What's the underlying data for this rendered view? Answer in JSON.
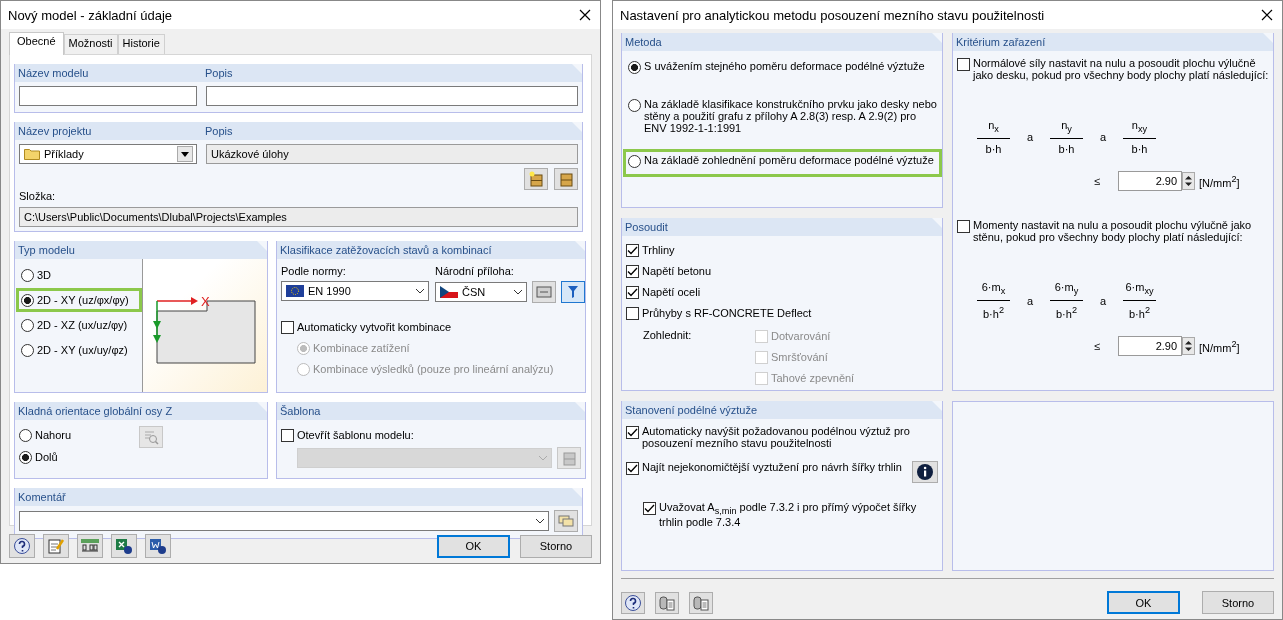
{
  "left_dialog": {
    "title": "Nový model - základní údaje",
    "tabs": [
      {
        "label": "Obecné",
        "selected": true
      },
      {
        "label": "Možnosti",
        "selected": false
      },
      {
        "label": "Historie",
        "selected": false
      }
    ],
    "model": {
      "name_label": "Název modelu",
      "description_label": "Popis"
    },
    "project": {
      "name_label": "Název projektu",
      "name_value": "Příklady",
      "description_label": "Popis",
      "description_value": "Ukázkové úlohy",
      "folder_label": "Složka:",
      "folder_value": "C:\\Users\\Public\\Documents\\Dlubal\\Projects\\Examples"
    },
    "model_type": {
      "title": "Typ modelu",
      "axis_label": "X",
      "options": [
        {
          "label": "3D",
          "selected": false,
          "highlighted": false
        },
        {
          "label": "2D - XY (uz/φx/φy)",
          "selected": true,
          "highlighted": true
        },
        {
          "label": "2D - XZ (ux/uz/φy)",
          "selected": false,
          "highlighted": false
        },
        {
          "label": "2D - XY (ux/uy/φz)",
          "selected": false,
          "highlighted": false
        }
      ]
    },
    "classification": {
      "title": "Klasifikace zatěžovacích stavů a kombinací",
      "norm_label": "Podle normy:",
      "norm_value": "EN 1990",
      "annex_label": "Národní příloha:",
      "annex_value": "ČSN",
      "auto_combinations": {
        "label": "Automaticky vytvořit kombinace",
        "checked": false
      },
      "combination_types": [
        {
          "label": "Kombinace zatížení",
          "selected": true,
          "disabled": true
        },
        {
          "label": "Kombinace výsledků (pouze pro lineární analýzu)",
          "selected": false,
          "disabled": true
        }
      ]
    },
    "z_axis": {
      "title": "Kladná orientace globální osy Z",
      "options": [
        {
          "label": "Nahoru",
          "selected": false
        },
        {
          "label": "Dolů",
          "selected": true
        }
      ]
    },
    "template": {
      "title": "Šablona",
      "open_template": {
        "label": "Otevřít šablonu modelu:",
        "checked": false
      }
    },
    "comment": {
      "title": "Komentář"
    },
    "buttons": [
      {
        "label": "OK",
        "default": true
      },
      {
        "label": "Storno",
        "default": false
      }
    ]
  },
  "right_dialog": {
    "title": "Nastavení pro analytickou metodu posouzení mezního stavu použitelnosti",
    "method": {
      "title": "Metoda",
      "options": [
        {
          "label": "S uvážením stejného poměru deformace podélné výztuže",
          "selected": true,
          "highlighted": false
        },
        {
          "label": "Na základě klasifikace konstrukčního prvku jako desky nebo stěny a použití grafu z přílohy A 2.8(3) resp. A 2.9(2) pro ENV 1992-1-1:1991",
          "selected": false,
          "highlighted": false
        },
        {
          "label": "Na základě zohlednění poměru deformace podélné výztuže",
          "selected": false,
          "highlighted": true
        }
      ]
    },
    "check": {
      "title": "Posoudit",
      "items": [
        {
          "label": "Trhliny",
          "checked": true
        },
        {
          "label": "Napětí betonu",
          "checked": true
        },
        {
          "label": "Napětí oceli",
          "checked": true
        },
        {
          "label": "Průhyby s RF-CONCRETE Deflect",
          "checked": false
        }
      ],
      "consider_label": "Zohlednit:",
      "consider_items": [
        {
          "label": "Dotvarování",
          "checked": false,
          "disabled": true
        },
        {
          "label": "Smršťování",
          "checked": false,
          "disabled": true
        },
        {
          "label": "Tahové zpevnění",
          "checked": false,
          "disabled": true
        }
      ]
    },
    "reinforcement": {
      "title": "Stanovení podélné výztuže",
      "items": [
        {
          "kind": "plain",
          "label": "Automaticky navýšit požadovanou podélnou výztuž pro posouzení mezního stavu použitelnosti",
          "checked": true
        },
        {
          "kind": "info",
          "label": "Najít nejekonomičtější vyztužení pro návrh šířky trhlin",
          "checked": true
        },
        {
          "kind": "sub",
          "label": "Uvažovat A$_{s,min}$ podle 7.3.2 i pro přímý výpočet šířky trhlin podle 7.3.4",
          "checked": true
        }
      ]
    },
    "criterion": {
      "title": "Kritérium zařazení",
      "conditions": [
        {
          "label": "Normálové síly nastavit na nulu a posoudit plochu výlučně jako desku, pokud pro všechny body plochy platí následující:",
          "checked": false,
          "terms": [
            {
              "kind": "fraction",
              "numerator": "n$_{x}$",
              "denominator": "b·h"
            },
            {
              "kind": "word",
              "text": "a"
            },
            {
              "kind": "fraction",
              "numerator": "n$_{y}$",
              "denominator": "b·h"
            },
            {
              "kind": "word",
              "text": "a"
            },
            {
              "kind": "fraction",
              "numerator": "n$_{xy}$",
              "denominator": "b·h"
            }
          ],
          "relation": "≤",
          "value": "2.90",
          "unit": "[N/mm$^{2}$]"
        },
        {
          "label": "Momenty nastavit na nulu a posoudit plochu výlučně jako stěnu, pokud pro všechny body plochy platí následující:",
          "checked": false,
          "terms": [
            {
              "kind": "fraction",
              "numerator": "6·m$_{x}$",
              "denominator": "b·h$^{2}$"
            },
            {
              "kind": "word",
              "text": "a"
            },
            {
              "kind": "fraction",
              "numerator": "6·m$_{y}$",
              "denominator": "b·h$^{2}$"
            },
            {
              "kind": "word",
              "text": "a"
            },
            {
              "kind": "fraction",
              "numerator": "6·m$_{xy}$",
              "denominator": "b·h$^{2}$"
            }
          ],
          "relation": "≤",
          "value": "2.90",
          "unit": "[N/mm$^{2}$]"
        }
      ]
    },
    "buttons": [
      {
        "label": "OK",
        "default": true
      },
      {
        "label": "Storno",
        "default": false
      }
    ]
  }
}
